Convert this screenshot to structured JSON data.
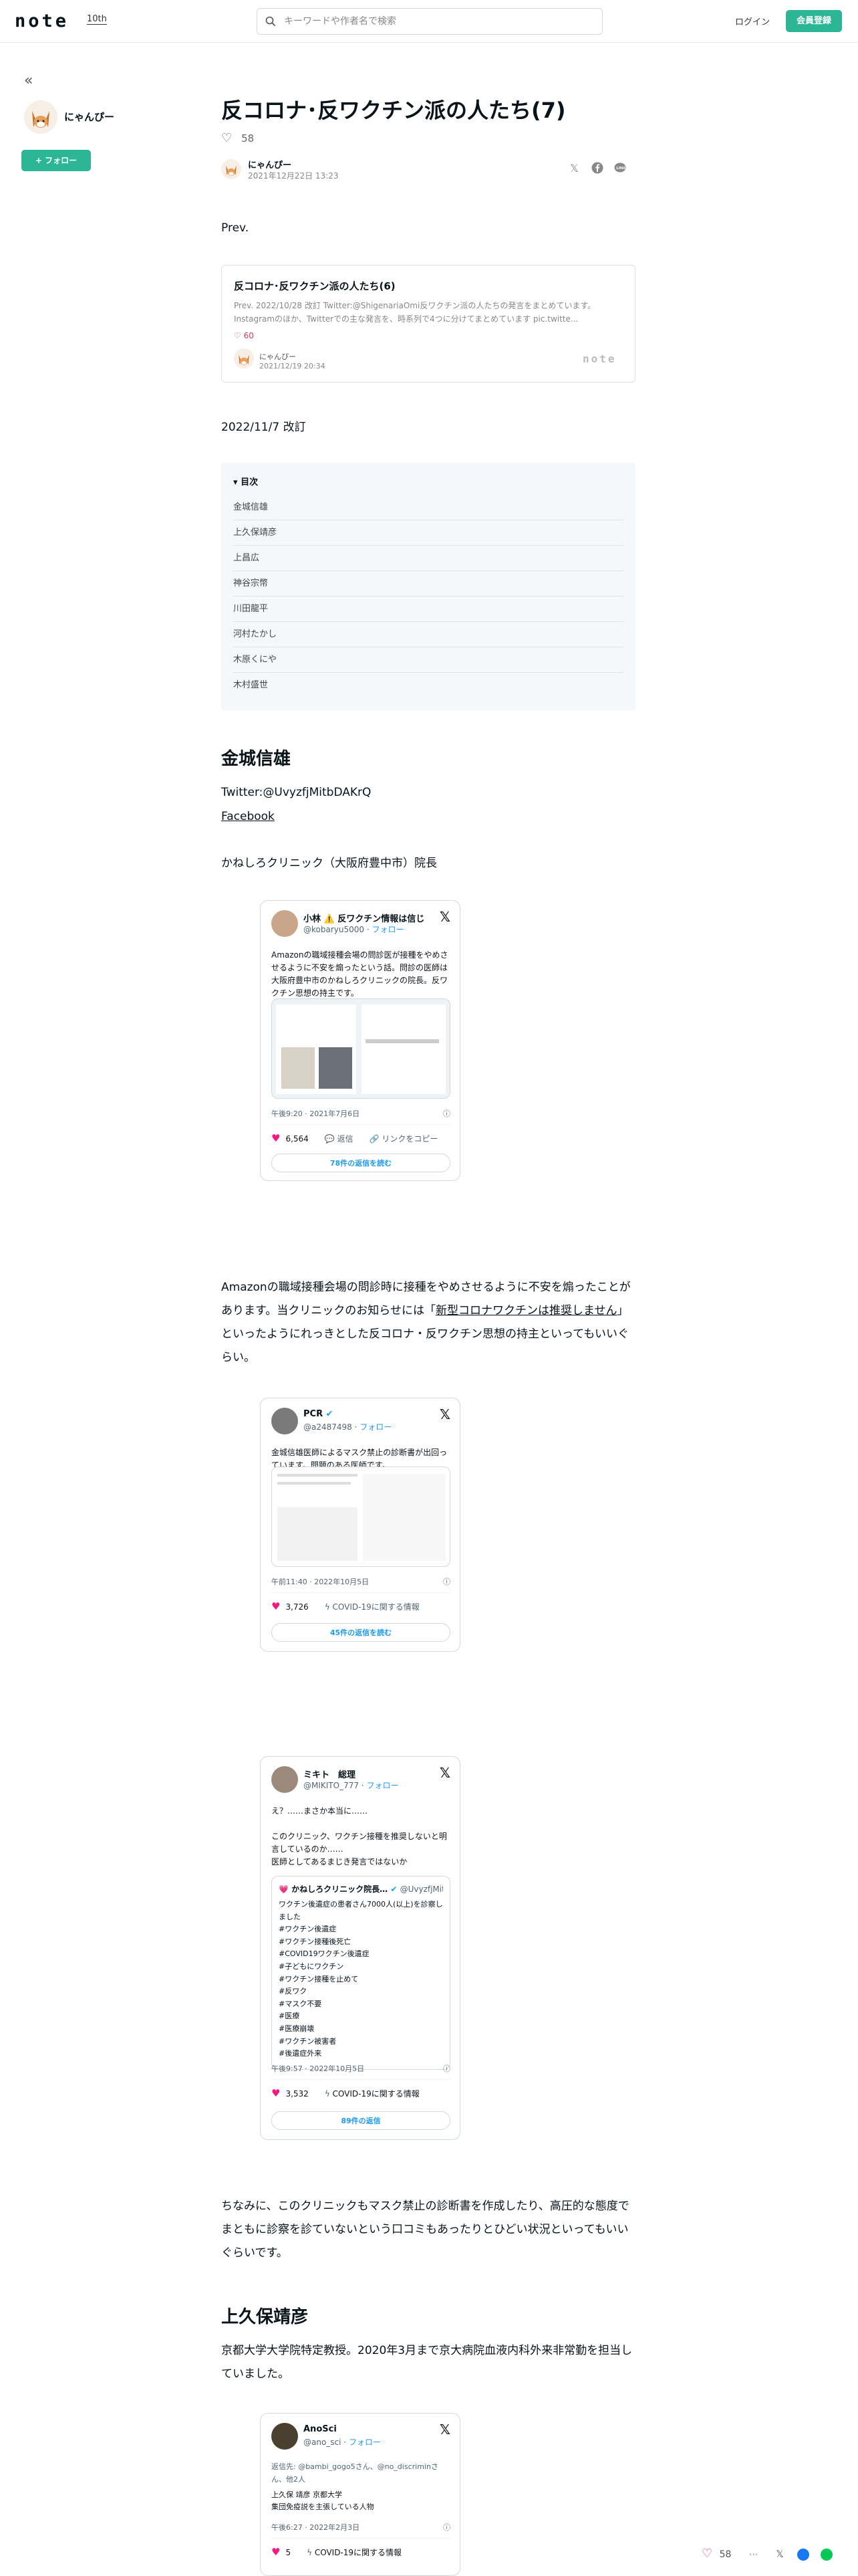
{
  "header": {
    "logo": "note",
    "logo_sub": "10th",
    "search_placeholder": "キーワードや作者名で検索",
    "login": "ログイン",
    "signup": "会員登録"
  },
  "sidebar": {
    "collapse": "«",
    "name": "にゃんぴー",
    "follow": "+ フォロー"
  },
  "article": {
    "title": "反コロナ･反ワクチン派の人たち(7)",
    "like_count": "58",
    "author": "にゃんぴー",
    "date": "2021年12月22日 13:23",
    "prev": "Prev.",
    "card": {
      "title": "反コロナ･反ワクチン派の人たち(6)",
      "desc": "Prev. 2022/10/28 改訂 Twitter:@ShigenariaOmi反ワクチン派の人たちの発言をまとめています。Instagramのほか、Twitterでの主な発言を、時系列で4つに分けてまとめています pic.twitte...",
      "likes": "60",
      "author": "にゃんぴー",
      "date": "2021/12/19 20:34",
      "logo": "note"
    },
    "revised": "2022/11/7 改訂",
    "toc": {
      "heading": "目次",
      "items": [
        "金城信雄",
        "上久保靖彦",
        "上昌広",
        "神谷宗幣",
        "川田龍平",
        "河村たかし",
        "木原くにや",
        "木村盛世"
      ]
    },
    "sec1": {
      "heading": "金城信雄",
      "twitter": "Twitter:@UvyzfjMitbDAKrQ",
      "facebook": "Facebook",
      "clinic": "かねしろクリニック（大阪府豊中市）院長",
      "para1_a": "Amazonの職域接種会場の問診時に接種をやめさせるように不安を煽ったことがあります。当クリニックのお知らせには「",
      "para1_link": "新型コロナワクチンは推奨しません",
      "para1_b": "」といったようにれっきとした反コロナ・反ワクチン思想の持主といってもいいぐらい。",
      "para2": "ちなみに、このクリニックもマスク禁止の診断書を作成したり、高圧的な態度でまともに診察を診ていないという口コミもあったりとひどい状況といってもいいぐらいです。"
    },
    "sec2": {
      "heading": "上久保靖彦",
      "para": "京都大学大学院特定教授。2020年3月まで京大病院血液内科外来非常勤を担当していました。"
    }
  },
  "tweets": [
    {
      "name": "小林 ⚠️ 反ワクチン情報は信じないで",
      "handle": "@kobaryu5000",
      "follow": "フォロー",
      "text": "Amazonの職域接種会場の問診医が接種をやめさせるように不安を煽ったという話。問診の医師は大阪府豊中市のかねしろクリニックの院長。反ワクチン思想の持主です。",
      "time": "午後9:20 · 2021年7月6日",
      "likes": "6,564",
      "reply": "返信",
      "share": "リンクをコピー",
      "more": "78件の返信を読む"
    },
    {
      "name": "PCR",
      "handle": "@a2487498",
      "follow": "フォロー",
      "text": "金城信雄医師によるマスク禁止の診断書が出回っています。問題のある医師です。",
      "time": "午前11:40 · 2022年10月5日",
      "likes": "3,726",
      "topic": "COVID-19に関する情報",
      "more": "45件の返信を読む"
    },
    {
      "name": "ミキト　総理",
      "handle": "@MIKITO_777",
      "follow": "フォロー",
      "text1": "え？……まさか本当に……",
      "text2": "このクリニック、ワクチン接種を推奨しないと明言しているのか……",
      "text3": "医師としてあるまじき発言ではないか",
      "quote_name": "かねしろクリニック院長…",
      "quote_handle": "@UvyzfjMitb…",
      "quote_lines": [
        "ワクチン後遺症の患者さん7000人(以上)を診察しました",
        "#ワクチン後遺症",
        "#ワクチン接種後死亡",
        "#COVID19ワクチン後遺症",
        "#子どもにワクチン",
        "#ワクチン接種を止めて",
        "#反ワク",
        "#マスク不要",
        "#医療",
        "#医療崩壊",
        "#ワクチン被害者",
        "#後遺症外来"
      ],
      "time": "午後9:57 · 2022年10月5日",
      "likes": "3,532",
      "topic": "COVID-19に関する情報",
      "more": "89件の返信"
    },
    {
      "name": "AnoSci",
      "handle": "@ano_sci",
      "follow": "フォロー",
      "reply_to": "返信先: @bambi_gogo5さん、@no_discriminさん、他2人",
      "text1": "上久保 靖彦 京都大学",
      "text2": "集団免疫説を主張している人物",
      "time": "午後6:27 · 2022年2月3日",
      "likes": "5",
      "topic": "COVID-19に関する情報"
    }
  ],
  "floating_bar": {
    "likes": "58"
  },
  "colors": {
    "brand": "#2cb696",
    "like": "#d53f5e",
    "twitter_blue": "#1d9bf0",
    "toc_bg": "#f5f8fa"
  }
}
